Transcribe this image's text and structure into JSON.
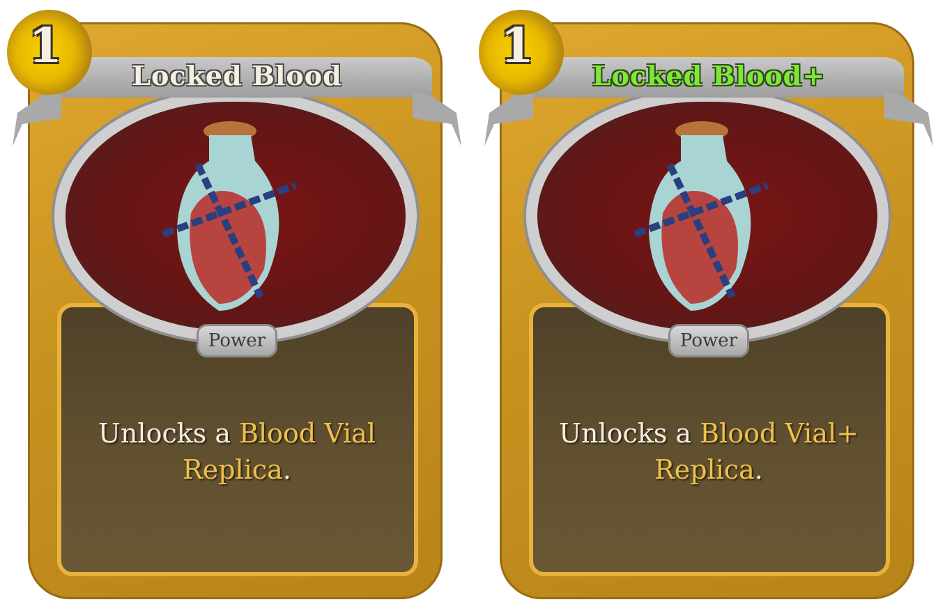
{
  "cards": [
    {
      "cost": "1",
      "title": "Locked Blood",
      "type": "Power",
      "description": {
        "prefix": "Unlocks a ",
        "keyword1": "Blood Vial",
        "break": "",
        "keyword2": "Replica",
        "suffix": "."
      }
    },
    {
      "cost": "1",
      "title": "Locked Blood+",
      "type": "Power",
      "description": {
        "prefix": "Unlocks a ",
        "keyword1": "Blood Vial+",
        "break": "",
        "keyword2": "Replica",
        "suffix": "."
      }
    }
  ],
  "colors": {
    "frame": "#d9a22a",
    "upgraded_title": "#7ee83a",
    "keyword": "#efc14a"
  }
}
